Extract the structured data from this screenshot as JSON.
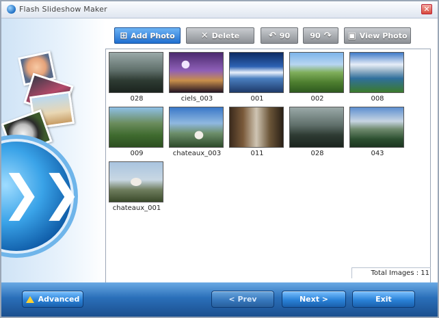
{
  "window": {
    "title": "Flash Slideshow Maker",
    "close_symbol": "✕"
  },
  "toolbar": {
    "add_photo": "Add Photo",
    "delete": "Delete",
    "rotate_left": "90",
    "rotate_right": "90",
    "view_photo": "View Photo"
  },
  "photos": [
    {
      "caption": "028"
    },
    {
      "caption": "ciels_003"
    },
    {
      "caption": "001"
    },
    {
      "caption": "002"
    },
    {
      "caption": "008"
    },
    {
      "caption": "009"
    },
    {
      "caption": "chateaux_003"
    },
    {
      "caption": "011"
    },
    {
      "caption": "028"
    },
    {
      "caption": "043"
    },
    {
      "caption": "chateaux_001"
    }
  ],
  "status": {
    "total_images": "Total Images : 11"
  },
  "footer": {
    "advanced": "Advanced",
    "prev": "< Prev",
    "next": "Next >",
    "exit": "Exit"
  },
  "colors": {
    "accent": "#1f6fd0",
    "footer": "#2a6fb9"
  }
}
